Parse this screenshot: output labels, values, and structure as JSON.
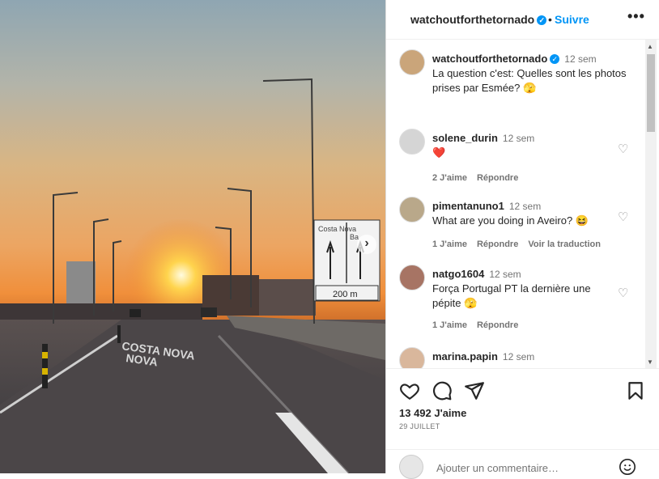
{
  "post": {
    "author": "watchoutforthetornado",
    "follow_label": "Suivre",
    "dot": "•",
    "more_label": "•••",
    "caption_time": "12 sem",
    "caption": "La question c'est: Quelles sont les photos prises par Esmée? 🫣"
  },
  "image": {
    "sign_top_left": "Costa Nova",
    "sign_top_right": "Ba",
    "sign_distance": "200 m",
    "road_text_1": "COSTA NOVA",
    "road_text_2": "NOVA",
    "next_icon": "chevron-right-icon"
  },
  "comments": [
    {
      "user": "solene_durin",
      "time": "12 sem",
      "text": "❤️",
      "likes": "2 J'aime",
      "reply": "Répondre",
      "translate": ""
    },
    {
      "user": "pimentanuno1",
      "time": "12 sem",
      "text": "What are you doing in Aveiro? 😆",
      "likes": "1 J'aime",
      "reply": "Répondre",
      "translate": "Voir la traduction"
    },
    {
      "user": "natgo1604",
      "time": "12 sem",
      "text": "Força Portugal PT la dernière une pépite 🫣",
      "likes": "1 J'aime",
      "reply": "Répondre",
      "translate": ""
    },
    {
      "user": "marina.papin",
      "time": "12 sem",
      "text": "",
      "likes": "",
      "reply": "",
      "translate": ""
    }
  ],
  "actions": {
    "likes_count": "13 492 J'aime",
    "date": "29 JUILLET",
    "icons": [
      "heart-icon",
      "comment-icon",
      "share-icon",
      "save-icon"
    ]
  },
  "add_comment": {
    "placeholder": "Ajouter un commentaire…",
    "emoji_icon": "emoji-icon"
  },
  "colors": {
    "accent": "#0095f6",
    "like_red": "#ed4956"
  }
}
